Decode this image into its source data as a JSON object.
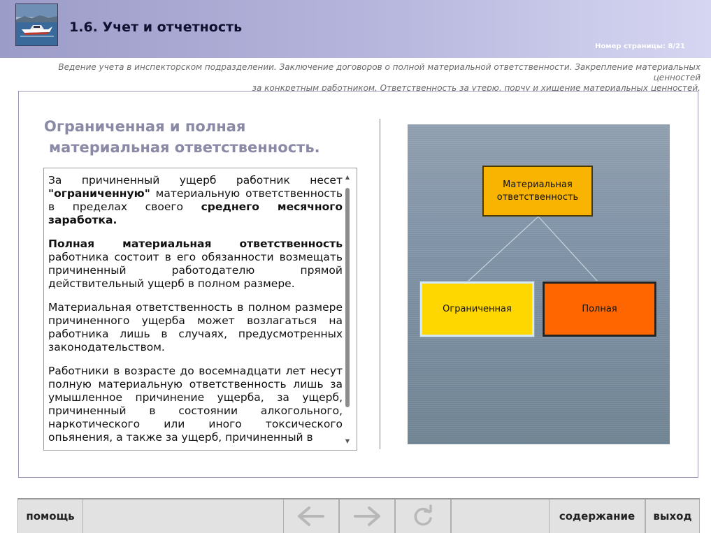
{
  "header": {
    "title": "1.6. Учет и отчетность",
    "page_number": "Номер страницы: 8/21"
  },
  "subtitle": {
    "line1": "Ведение учета в инспекторском подразделении. Заключение договоров о полной материальной ответственности. Закрепление материальных ценностей",
    "line2": "за конкретным работником. Ответственность за утерю, порчу и хищение материальных ценностей."
  },
  "section": {
    "title_line1": "Ограниченная и полная",
    "title_line2": "материальная ответственность."
  },
  "text": {
    "p1_a": "За причиненный ущерб работник несет ",
    "p1_bold1": "\"ограниченную\"",
    "p1_b": " материальную ответственность в пределах своего ",
    "p1_bold2": "среднего месячного заработка.",
    "p2_bold": "Полная материальная ответственность",
    "p2_a": " работника состоит в его обязанности возмещать причиненный работодателю прямой действительный ущерб в полном размере.",
    "p3": "Материальная ответственность в полном размере причиненного ущерба может возлагаться на работника лишь в случаях, предусмотренных законодательством.",
    "p4": "Работники в возрасте до восемнадцати лет несут полную материальную ответственность лишь за умышленное причинение ущерба, за ущерб, причиненный в состоянии алкогольного, наркотического или иного токсического опьянения, а также за ущерб, причиненный в"
  },
  "diagram": {
    "top_label_line1": "Материальная",
    "top_label_line2": "ответственность",
    "left_label": "Ограниченная",
    "right_label": "Полная",
    "colors": {
      "top": "#f8b400",
      "left": "#ffd700",
      "right": "#ff6600"
    }
  },
  "footer": {
    "help_label": "помощь",
    "contents_label": "содержание",
    "exit_label": "выход",
    "back_icon": "arrow-left-icon",
    "forward_icon": "arrow-right-icon",
    "reload_icon": "reload-icon"
  }
}
